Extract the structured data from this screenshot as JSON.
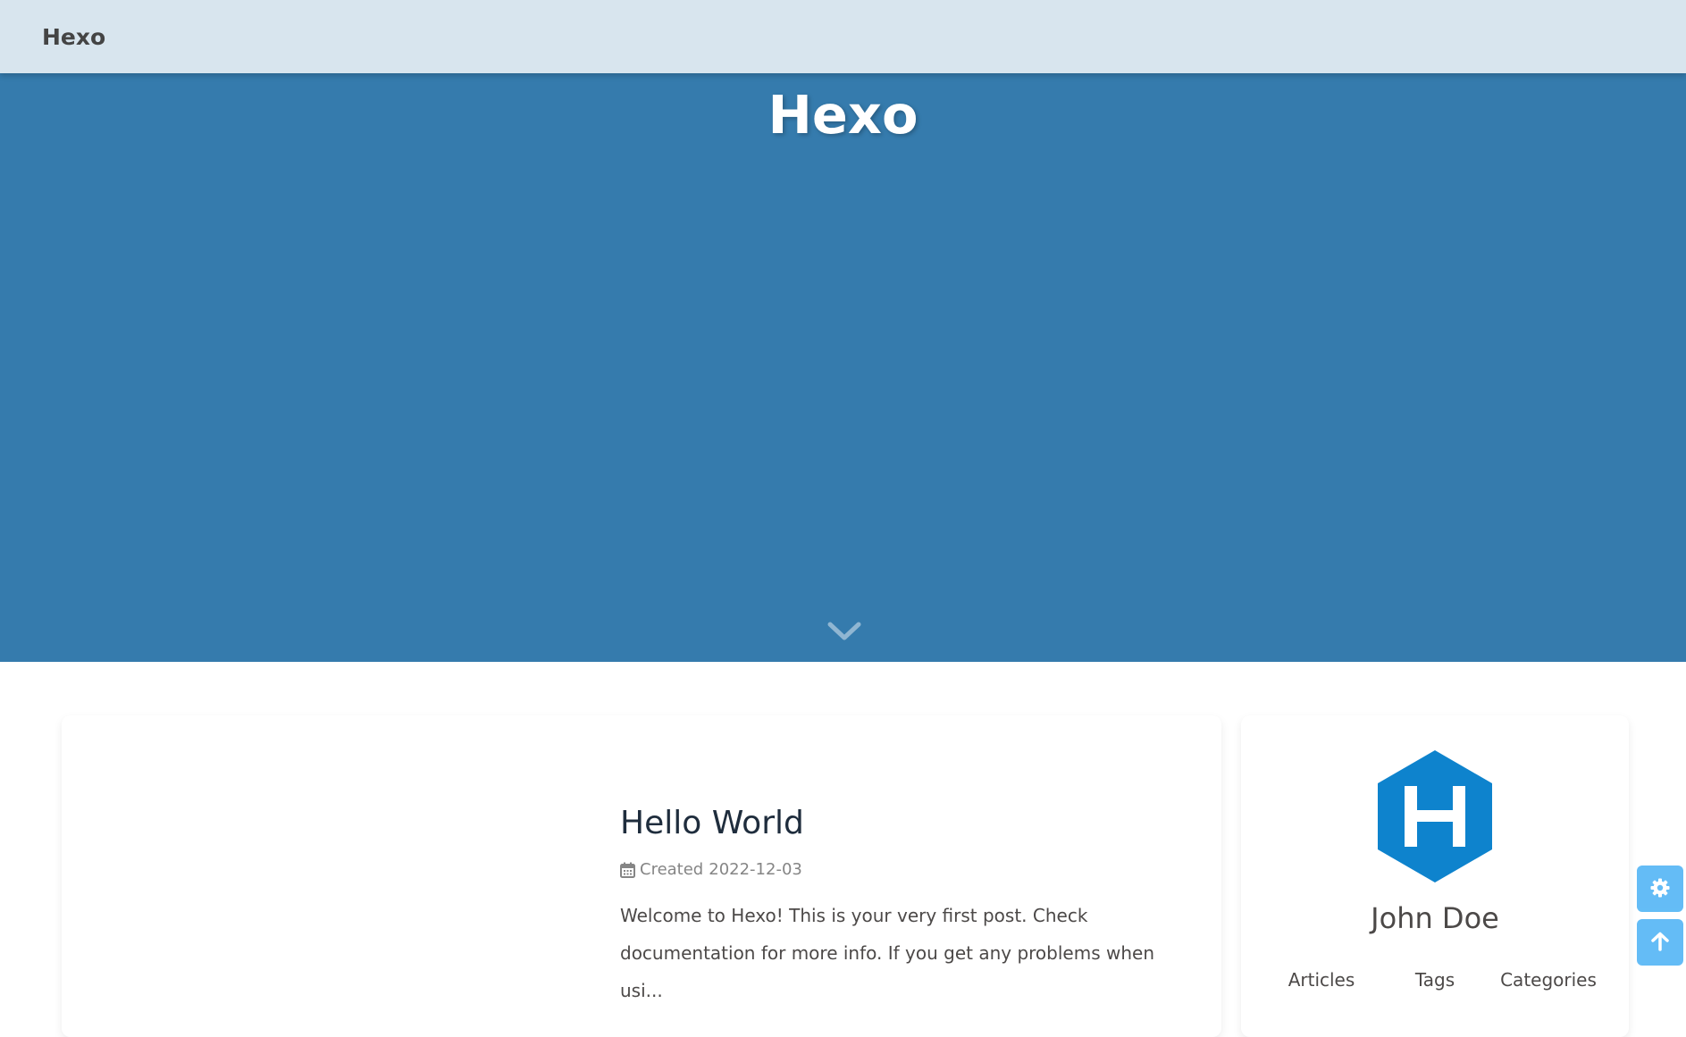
{
  "nav": {
    "site_name": "Hexo"
  },
  "hero": {
    "title": "Hexo",
    "scroll_icon": "chevron-down-icon"
  },
  "post": {
    "title": "Hello World",
    "meta_icon": "calendar-icon",
    "meta_label": "Created",
    "date": "2022-12-03",
    "excerpt": "Welcome to Hexo! This is your very first post. Check documentation for more info. If you get any problems when usi..."
  },
  "author": {
    "avatar_icon": "hexo-logo-icon",
    "name": "John Doe",
    "stats": [
      {
        "label": "Articles"
      },
      {
        "label": "Tags"
      },
      {
        "label": "Categories"
      }
    ]
  },
  "float_buttons": {
    "settings_icon": "gear-icon",
    "top_icon": "arrow-up-icon"
  },
  "colors": {
    "navbar_bg": "#d8e5ee",
    "hero_bg": "#357bad",
    "accent": "#49b1f5",
    "logo_blue": "#0e83cd"
  }
}
